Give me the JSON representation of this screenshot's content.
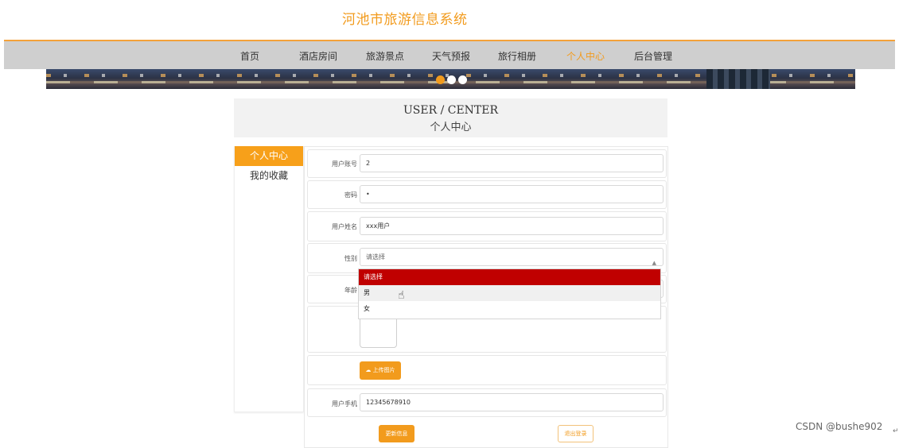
{
  "site": {
    "title": "河池市旅游信息系统"
  },
  "nav": {
    "items": [
      {
        "label": "首页"
      },
      {
        "label": "酒店房间"
      },
      {
        "label": "旅游景点"
      },
      {
        "label": "天气预报"
      },
      {
        "label": "旅行相册"
      },
      {
        "label": "个人中心"
      },
      {
        "label": "后台管理"
      }
    ],
    "active_index": 5
  },
  "banner": {
    "slide_count": 3,
    "active_slide": 1
  },
  "center": {
    "title_en": "USER / CENTER",
    "title_cn": "个人中心"
  },
  "sidebar": {
    "items": [
      {
        "label": "个人中心"
      },
      {
        "label": "我的收藏"
      }
    ],
    "active_index": 0
  },
  "form": {
    "account": {
      "label": "用户账号",
      "value": "2"
    },
    "password": {
      "label": "密码",
      "value": "•"
    },
    "name": {
      "label": "用户姓名",
      "value": "xxx用户"
    },
    "gender": {
      "label": "性别",
      "value": "请选择",
      "options": [
        "请选择",
        "男",
        "女"
      ]
    },
    "age": {
      "label": "年龄"
    },
    "upload": {
      "label": "上传图片"
    },
    "phone": {
      "label": "用户手机",
      "value": "12345678910"
    }
  },
  "actions": {
    "update": "更新信息",
    "logout": "退出登录"
  },
  "watermark": "CSDN @bushe902",
  "colors": {
    "accent": "#f29b1d",
    "nav_bg": "#cfcfcf",
    "selected_option": "#c00000"
  }
}
